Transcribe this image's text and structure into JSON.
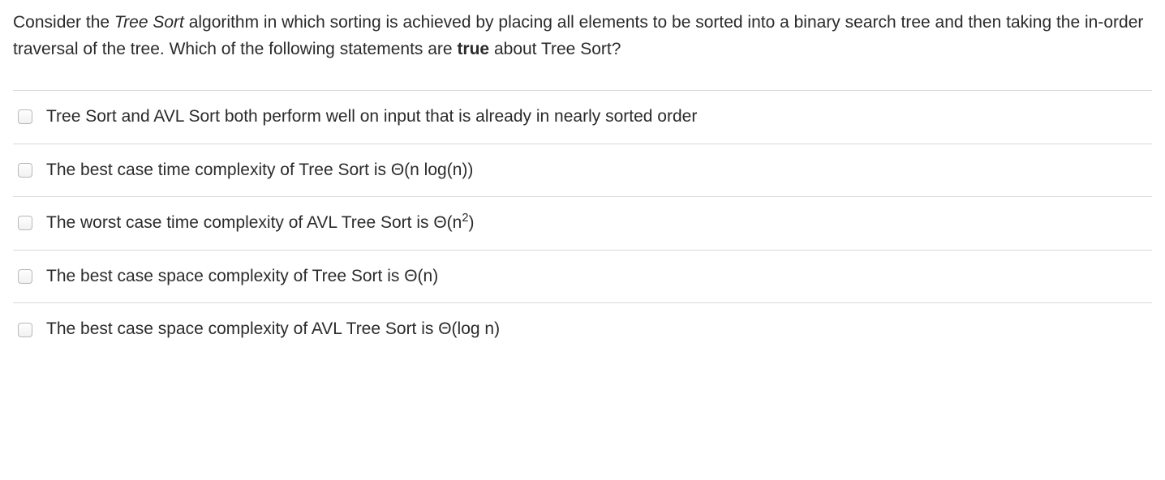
{
  "question": {
    "pre": "Consider the ",
    "italic": "Tree Sort",
    "mid": " algorithm in which sorting is achieved by placing all elements to be sorted into a binary search tree and then taking the in-order traversal of the tree. Which of the following statements are ",
    "bold": "true",
    "post": " about Tree Sort?"
  },
  "options": [
    {
      "text": "Tree Sort and AVL Sort both perform well on input that is already in nearly sorted order"
    },
    {
      "text": "The best case time complexity of Tree Sort is Θ(n log(n))"
    },
    {
      "pre": "The worst case time complexity of AVL Tree Sort is Θ(n",
      "sup": "2",
      "post": ")"
    },
    {
      "text": "The best case space complexity of Tree Sort is Θ(n)"
    },
    {
      "text": "The best case space complexity of AVL Tree Sort is Θ(log n)"
    }
  ]
}
